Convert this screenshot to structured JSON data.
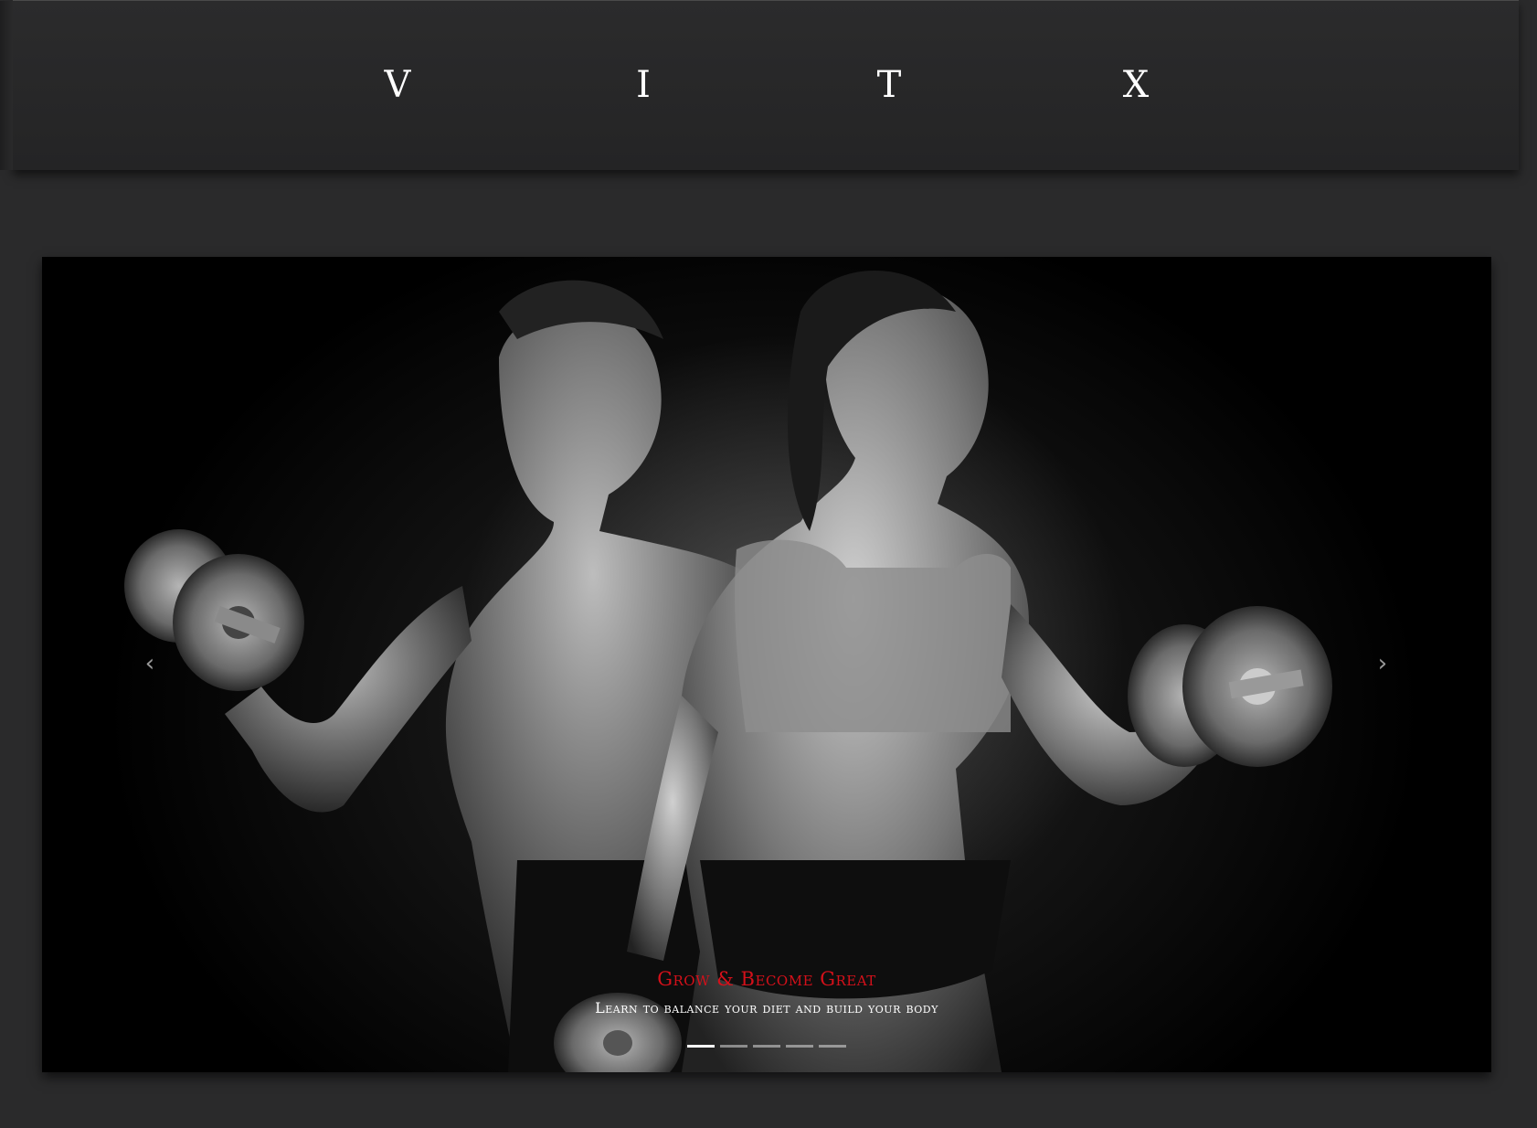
{
  "header": {
    "nav": [
      {
        "label": "V"
      },
      {
        "label": "I"
      },
      {
        "label": "T"
      },
      {
        "label": "X"
      }
    ]
  },
  "carousel": {
    "caption_title": "Grow & Become Great",
    "caption_subtitle": "Learn to balance your diet and build your body",
    "prev_icon": "‹",
    "next_icon": "›",
    "slide_count": 5,
    "active_slide": 1,
    "image_description_icon": "fitness-couple-dumbbells-image"
  },
  "colors": {
    "background": "#2a2a2b",
    "accent": "#d4101a",
    "text": "#ffffff"
  }
}
